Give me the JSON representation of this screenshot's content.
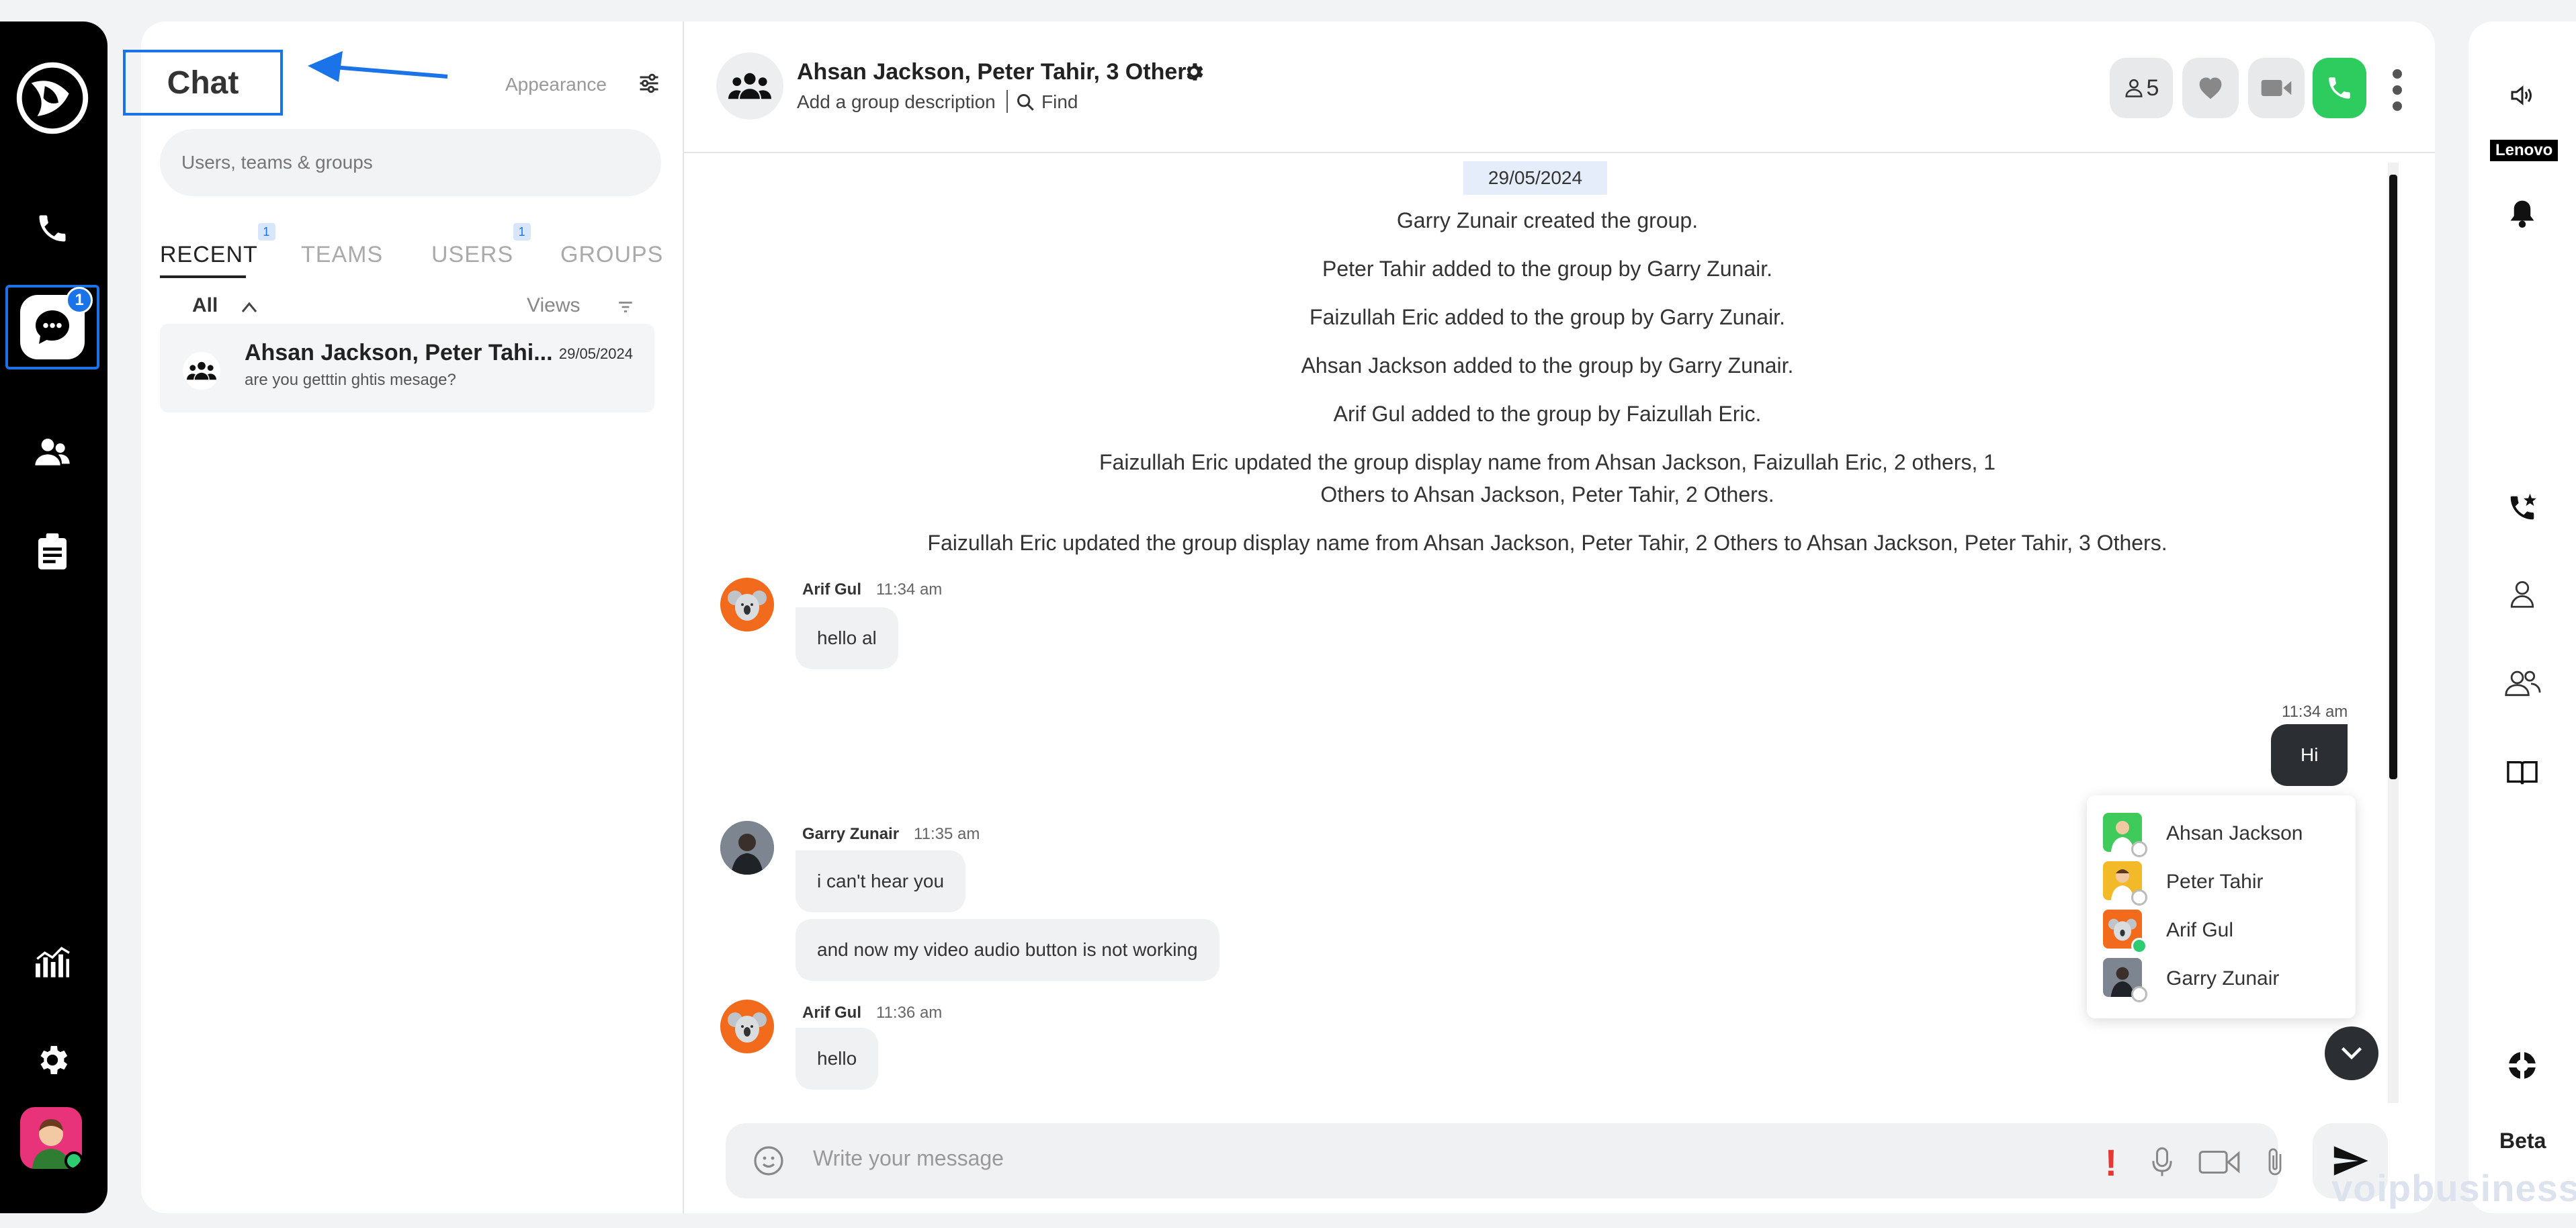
{
  "colors": {
    "accent": "#1a73e8",
    "call_green": "#2ecc5f",
    "dark_bubble": "#2b2f33",
    "koala_orange": "#f26a1b"
  },
  "nav": {
    "items": [
      "logo-icon",
      "phone-icon",
      "chat-icon",
      "contacts-icon",
      "notes-icon",
      "analytics-icon",
      "settings-icon"
    ],
    "chat_badge": "1"
  },
  "list": {
    "title": "Chat",
    "appearance": "Appearance",
    "search_placeholder": "Users, teams & groups",
    "tabs": [
      {
        "label": "RECENT",
        "badge": "1"
      },
      {
        "label": "TEAMS",
        "badge": ""
      },
      {
        "label": "USERS",
        "badge": "1"
      },
      {
        "label": "GROUPS",
        "badge": ""
      }
    ],
    "filter_all": "All",
    "views": "Views",
    "conversations": [
      {
        "name": "Ahsan Jackson, Peter Tahi...",
        "date": "29/05/2024",
        "preview": "are you getttin ghtis mesage?"
      }
    ]
  },
  "header": {
    "title": "Ahsan Jackson, Peter Tahir, 3 Others",
    "description": "Add a group description",
    "find": "Find",
    "members_count": "5"
  },
  "messages": {
    "date": "29/05/2024",
    "system": [
      "Garry Zunair created the group.",
      "Peter Tahir added to the group by Garry Zunair.",
      "Faizullah Eric added to the group by Garry Zunair.",
      "Ahsan Jackson added to the group by Garry Zunair.",
      "Arif Gul added to the group by Faizullah Eric.",
      "Faizullah Eric updated the group display name from Ahsan Jackson, Faizullah Eric, 2 others, 1 Others to Ahsan Jackson, Peter Tahir, 2 Others.",
      "Faizullah Eric updated the group display name from Ahsan Jackson, Peter Tahir, 2 Others to Ahsan Jackson, Peter Tahir, 3 Others."
    ],
    "m1": {
      "sender": "Arif Gul",
      "time": "11:34 am",
      "text": "hello al"
    },
    "m2": {
      "time": "11:34 am",
      "text": "Hi"
    },
    "m3": {
      "sender": "Garry Zunair",
      "time": "11:35 am",
      "text1": "i can't hear you",
      "text2": "and now my video audio button is not working"
    },
    "m4": {
      "sender": "Arif Gul",
      "time": "11:36 am",
      "text": "hello"
    }
  },
  "readers": [
    "Ahsan Jackson",
    "Peter Tahir",
    "Arif Gul",
    "Garry Zunair"
  ],
  "composer": {
    "placeholder": "Write your message",
    "priority": "!"
  },
  "right_rail": {
    "device": "Lenovo",
    "beta": "Beta"
  },
  "watermark": "voipbusiness"
}
